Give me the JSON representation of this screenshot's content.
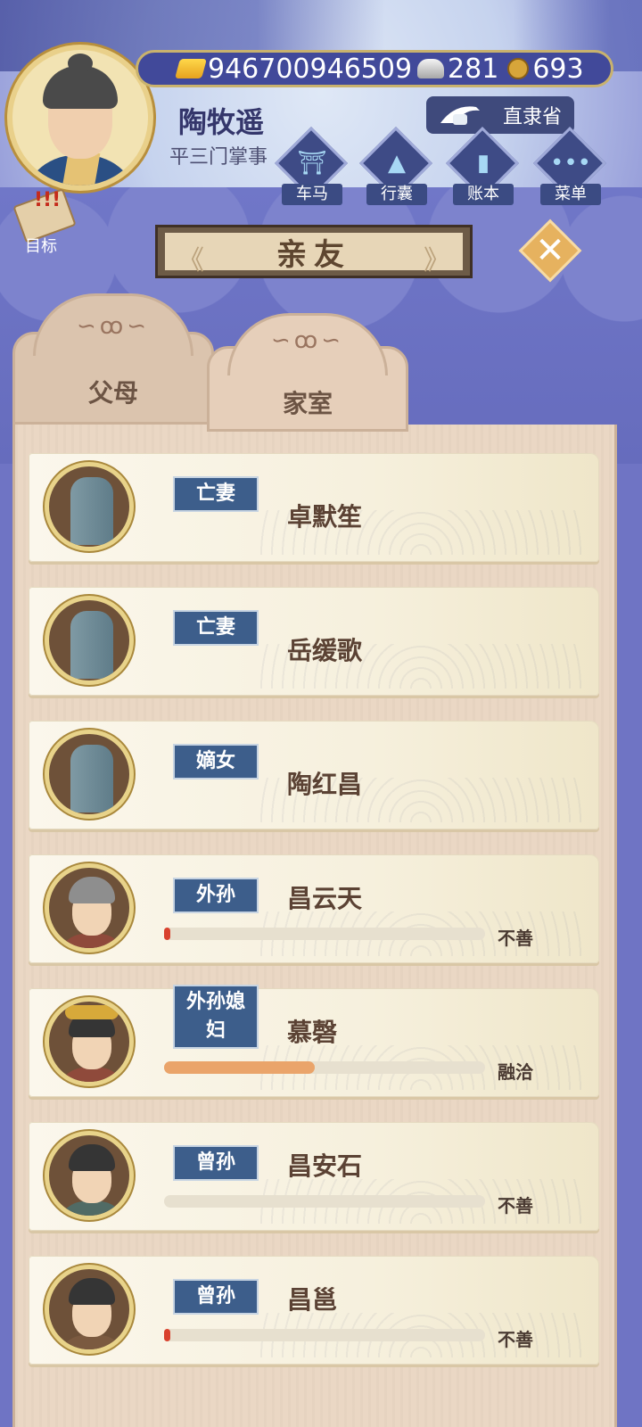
{
  "player": {
    "name": "陶牧遥",
    "title": "平三门掌事",
    "gold": "946700946509",
    "silver": "281",
    "coins": "693",
    "province": "直隶省"
  },
  "menu": [
    {
      "label": "车马",
      "icon": "carriage-icon",
      "glyph": "⛩"
    },
    {
      "label": "行囊",
      "icon": "bag-icon",
      "glyph": "▲"
    },
    {
      "label": "账本",
      "icon": "ledger-icon",
      "glyph": "▮"
    },
    {
      "label": "菜单",
      "icon": "more-icon",
      "glyph": "•••"
    }
  ],
  "target_label": "目标",
  "page_title": "亲友",
  "tabs": [
    {
      "label": "父母",
      "selected": false
    },
    {
      "label": "家室",
      "selected": true
    }
  ],
  "relatives": [
    {
      "relation": "亡妻",
      "name": "卓默笙",
      "deceased": true
    },
    {
      "relation": "亡妻",
      "name": "岳缓歌",
      "deceased": true
    },
    {
      "relation": "嫡女",
      "name": "陶红昌",
      "deceased": true
    },
    {
      "relation": "外孙",
      "name": "昌云天",
      "deceased": false,
      "status": "不善",
      "affinity": 0.01
    },
    {
      "relation": "外孙媳妇",
      "name": "慕磬",
      "deceased": false,
      "status": "融洽",
      "affinity": 0.47
    },
    {
      "relation": "曾孙",
      "name": "昌安石",
      "deceased": false,
      "status": "不善",
      "affinity": 0.0
    },
    {
      "relation": "曾孙",
      "name": "昌邕",
      "deceased": false,
      "status": "不善",
      "affinity": 0.02
    }
  ],
  "colors": {
    "affinity_bad": "#d9412e",
    "affinity_good": "#eaa46a"
  }
}
